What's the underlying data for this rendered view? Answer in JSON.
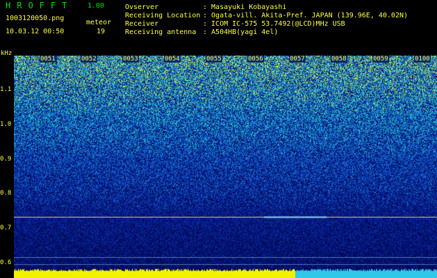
{
  "header": {
    "app_title": "HROFFT",
    "app_version": "1.00",
    "filename": "1003120050.png",
    "datetime": "10.03.12 00:50",
    "meteor_label": "meteor",
    "meteor_count": "19"
  },
  "info": [
    {
      "key": "Ovserver",
      "value": ": Masayuki Kobayashi"
    },
    {
      "key": "Receiving Location",
      "value": ": Ogata-vill. Akita-Pref. JAPAN (139.96E, 40.02N)"
    },
    {
      "key": "Receiver",
      "value": ": ICOM IC-575 53.7492(@LCD)MHz USB"
    },
    {
      "key": "Receiving antenna",
      "value": ": A504HB(yagi 4el)"
    }
  ],
  "axis": {
    "unit": "kHz",
    "y_ticks": [
      "1.1",
      "1.0",
      "0.9",
      "0.8",
      "0.7",
      "0.6"
    ],
    "x_ticks": [
      "0051",
      "0052",
      "0053",
      "0054",
      "0055",
      "0056",
      "0057",
      "0058",
      "0059",
      "0100"
    ]
  },
  "colors": {
    "bg": "#000000",
    "title_green": "#00e000",
    "label_yellow": "#ffff40",
    "info_white": "#ffffff",
    "carrier_line": "#d8d880"
  }
}
